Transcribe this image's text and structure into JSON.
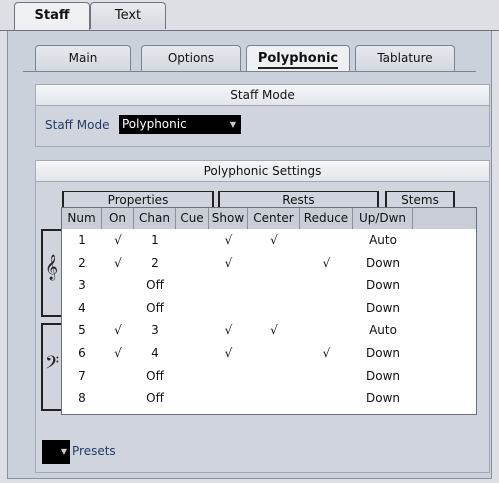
{
  "top_tabs": [
    "Staff",
    "Text"
  ],
  "inner_tabs": [
    "Main",
    "Options",
    "Polyphonic",
    "Tablature"
  ],
  "staff_mode": {
    "header": "Staff Mode",
    "label": "Staff Mode",
    "value": "Polyphonic"
  },
  "poly": {
    "header": "Polyphonic Settings",
    "groups": {
      "properties": "Properties",
      "rests": "Rests",
      "stems": "Stems"
    },
    "columns": [
      "Num",
      "On",
      "Chan",
      "Cue",
      "Show",
      "Center",
      "Reduce",
      "Up/Dwn"
    ],
    "rows": [
      [
        "1",
        "√",
        "1",
        "",
        "√",
        "√",
        "",
        "Auto"
      ],
      [
        "2",
        "√",
        "2",
        "",
        "√",
        "",
        "√",
        "Down"
      ],
      [
        "3",
        "",
        "Off",
        "",
        "",
        "",
        "",
        "Down"
      ],
      [
        "4",
        "",
        "Off",
        "",
        "",
        "",
        "",
        "Down"
      ],
      [
        "5",
        "√",
        "3",
        "",
        "√",
        "√",
        "",
        "Auto"
      ],
      [
        "6",
        "√",
        "4",
        "",
        "√",
        "",
        "√",
        "Down"
      ],
      [
        "7",
        "",
        "Off",
        "",
        "",
        "",
        "",
        "Down"
      ],
      [
        "8",
        "",
        "Off",
        "",
        "",
        "",
        "",
        "Down"
      ]
    ],
    "clefs": [
      "treble-clef-icon",
      "bass-clef-icon"
    ]
  },
  "presets_label": "Presets"
}
